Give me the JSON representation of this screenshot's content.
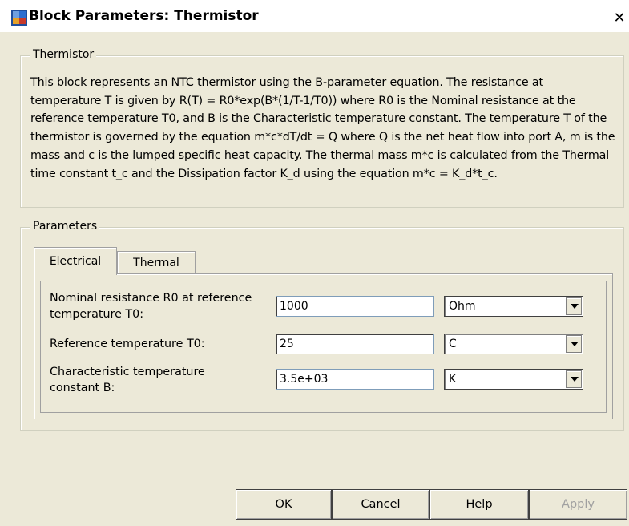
{
  "window": {
    "title": "Block Parameters: Thermistor",
    "close_glyph": "✕"
  },
  "description_group": {
    "legend": "Thermistor",
    "text": "This block represents an NTC thermistor using the B-parameter equation. The resistance at temperature T is given by R(T) = R0*exp(B*(1/T-1/T0)) where R0 is the Nominal resistance at the reference temperature T0, and B is the Characteristic temperature constant. The temperature T of the thermistor is governed by the equation m*c*dT/dt = Q where Q is the net heat flow into port A, m is the mass and c is the lumped specific heat capacity. The thermal mass m*c is calculated from the Thermal time constant t_c and the Dissipation factor K_d using the equation m*c = K_d*t_c."
  },
  "parameters_group": {
    "legend": "Parameters",
    "tabs": [
      {
        "label": "Electrical",
        "active": true
      },
      {
        "label": "Thermal",
        "active": false
      }
    ],
    "rows": [
      {
        "label_line1": "Nominal resistance R0 at reference",
        "label_line2": "temperature T0:",
        "value": "1000",
        "unit": "Ohm"
      },
      {
        "label_line1": "Reference temperature T0:",
        "label_line2": "",
        "value": "25",
        "unit": "C"
      },
      {
        "label_line1": "Characteristic temperature",
        "label_line2": "constant B:",
        "value": "3.5e+03",
        "unit": "K"
      }
    ]
  },
  "buttons": {
    "ok": "OK",
    "cancel": "Cancel",
    "help": "Help",
    "apply": "Apply"
  },
  "icons": {
    "window_icon": "simulink-block-icon",
    "dropdown_arrow": "chevron-down-icon"
  },
  "colors": {
    "dialog_bg": "#ece9d8",
    "disabled_text": "#a0a0a0"
  }
}
